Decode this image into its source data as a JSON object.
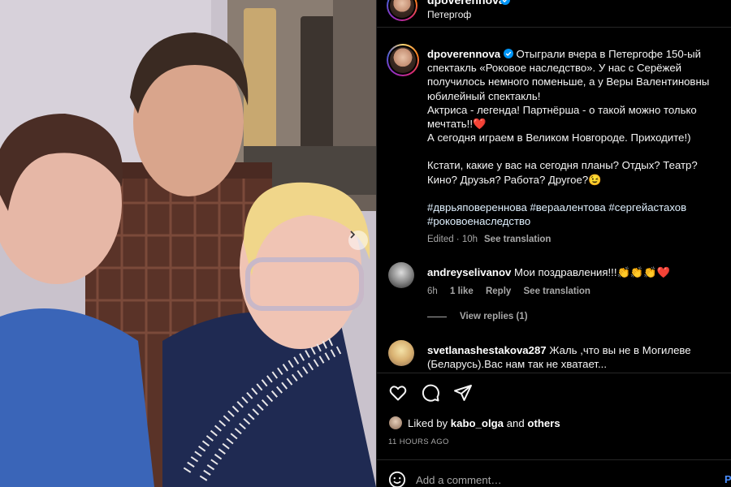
{
  "post": {
    "username": "dpoverennova",
    "location": "Петергоф"
  },
  "caption": {
    "username": "dpoverennova",
    "lines": [
      "Отыграли вчера в Петергофе 150-ый спектакль «Роковое наследство». У нас с Серёжей получилось немного поменьше, а у Веры Валентиновны юбилейный спектакль!",
      "Актриса - легенда! Партнёрша - о такой можно только мечтать!!❤️",
      "А сегодня играем в Великом Новгороде. Приходите!)"
    ],
    "question": "Кстати, какие у вас на сегодня планы? Отдых? Театр? Кино? Друзья? Работа? Другое?😉",
    "hashtags": "#дврьяповереннова #вераалентова #сергейастахов #роковоенаследство",
    "edited": "Edited · 10h",
    "see_translation": "See translation"
  },
  "comments": [
    {
      "username": "andreyselivanov",
      "text": "Мои поздравления!!!👏👏👏❤️",
      "time": "6h",
      "likes": "1 like",
      "reply": "Reply",
      "see_translation": "See translation"
    },
    {
      "username": "svetlanashestakova287",
      "text": "Жаль ,что вы не в Могилеве (Беларусь).Вас нам так не хватает..."
    }
  ],
  "view_replies": "View replies (1)",
  "likes": {
    "prefix": "Liked by",
    "user": "kabo_olga",
    "and": "and",
    "others": "others"
  },
  "timestamp": "11 HOURS AGO",
  "add_comment": {
    "placeholder": "Add a comment…",
    "post_label": "P"
  },
  "icons": {
    "like": "heart-icon",
    "comment": "comment-icon",
    "share": "share-icon",
    "verified": "verified-badge-icon",
    "carousel": "chevron-right-icon",
    "emoji": "emoji-icon"
  },
  "colors": {
    "background": "#000000",
    "verified": "#0095f6",
    "link": "#e0f1ff",
    "post_button": "#4a8eff"
  }
}
